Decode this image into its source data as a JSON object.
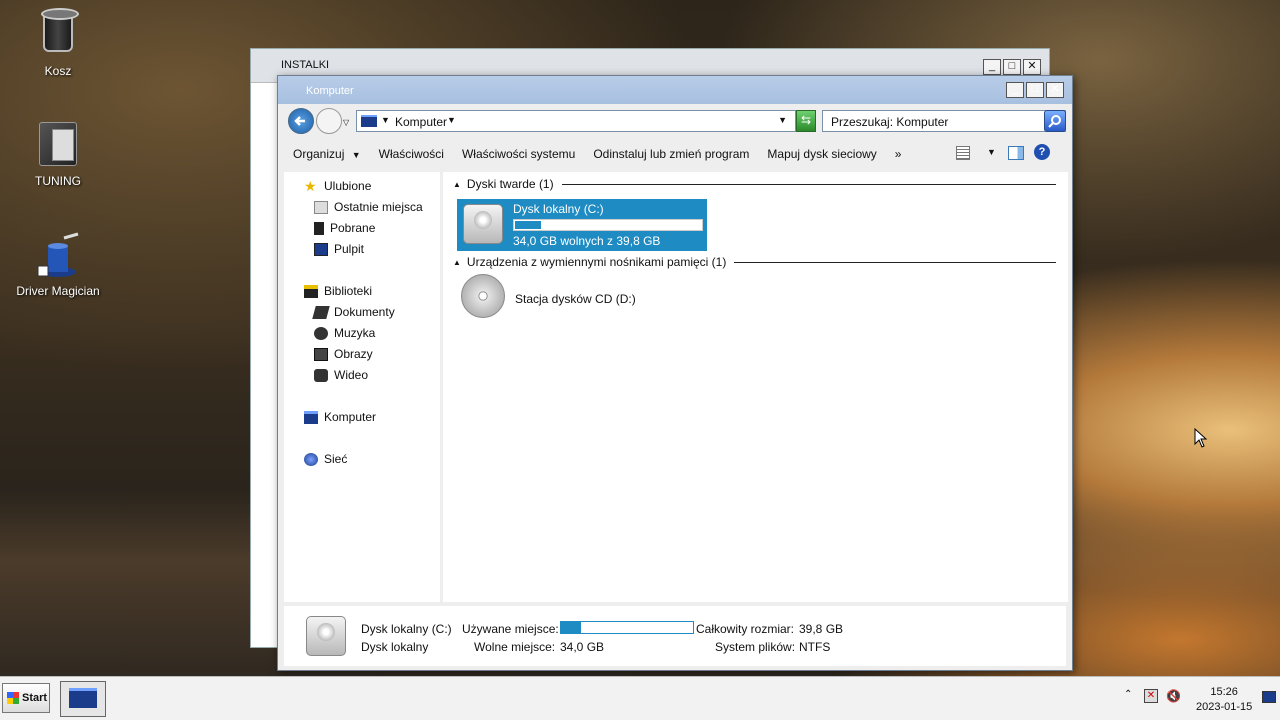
{
  "desktop": {
    "icons": [
      {
        "label": "Kosz",
        "icon": "recycle-bin-icon"
      },
      {
        "label": "TUNING",
        "icon": "folder-icon"
      },
      {
        "label": "Driver Magician",
        "icon": "driver-magician-icon"
      }
    ]
  },
  "back_window": {
    "title": "INSTALKI"
  },
  "window": {
    "title": "Komputer",
    "address": "Komputer",
    "search_placeholder": "Przeszukaj: Komputer",
    "toolbar": [
      "Organizuj",
      "Właściwości",
      "Właściwości systemu",
      "Odinstaluj lub zmień program",
      "Mapuj dysk sieciowy",
      "»"
    ],
    "nav": {
      "favorites": "Ulubione",
      "recent": "Ostatnie miejsca",
      "downloads": "Pobrane",
      "desktop": "Pulpit",
      "libraries": "Biblioteki",
      "documents": "Dokumenty",
      "music": "Muzyka",
      "pictures": "Obrazy",
      "video": "Wideo",
      "computer": "Komputer",
      "network": "Sieć"
    },
    "groups": {
      "hdd": "Dyski twarde (1)",
      "removable": "Urządzenia z wymiennymi nośnikami pamięci (1)"
    },
    "drive_c": {
      "name": "Dysk lokalny (C:)",
      "free_text": "34,0 GB wolnych z 39,8 GB",
      "used_fraction": 0.15
    },
    "drive_d": {
      "name": "Stacja dysków CD (D:)"
    },
    "status": {
      "name": "Dysk lokalny (C:)",
      "type": "Dysk lokalny",
      "used_label": "Używane miejsce:",
      "free_label": "Wolne miejsce:",
      "free_value": "34,0 GB",
      "total_label": "Całkowity rozmiar:",
      "total_value": "39,8 GB",
      "fs_label": "System plików:",
      "fs_value": "NTFS",
      "used_fraction": 0.15
    }
  },
  "taskbar": {
    "start": "Start",
    "time": "15:26",
    "date": "2023-01-15"
  },
  "colors": {
    "accent": "#1e8bc3",
    "title_bar": "#a8c0e0"
  }
}
